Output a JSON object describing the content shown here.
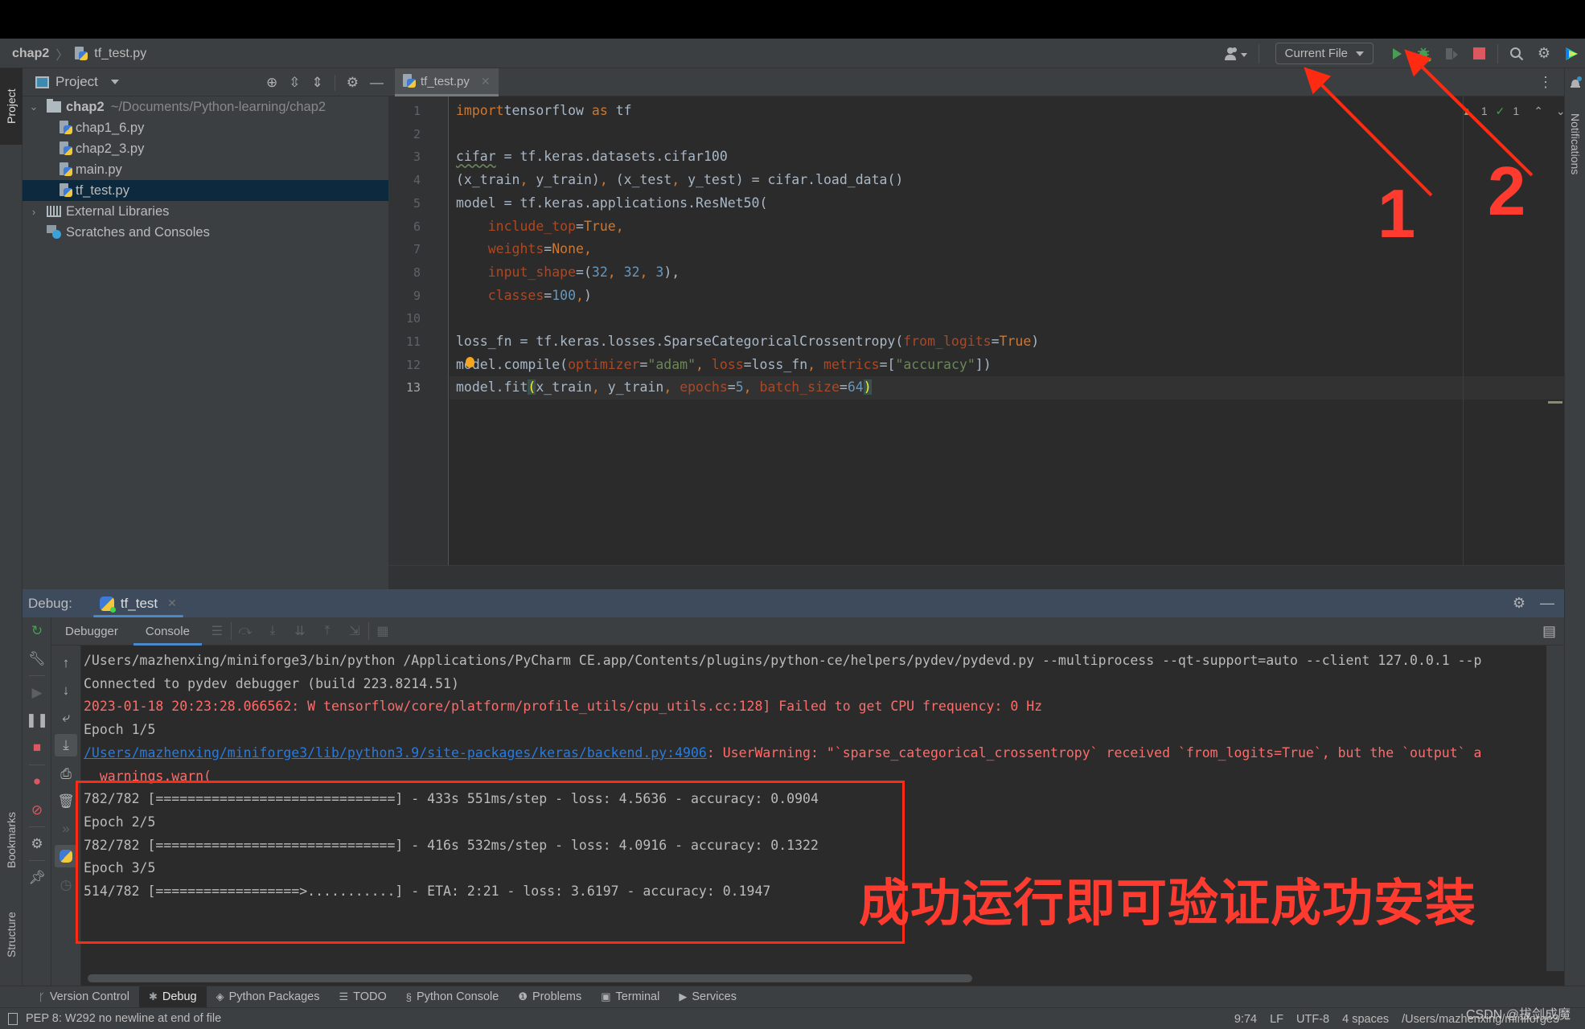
{
  "nav": {
    "project_name": "chap2",
    "file_name": "tf_test.py",
    "run_config": "Current File",
    "icons": [
      "user-icon",
      "run-icon",
      "debug-icon",
      "coverage-icon",
      "stop-icon",
      "search-icon",
      "settings-icon",
      "toolbox-icon"
    ]
  },
  "left_strip": {
    "project_tab": "Project",
    "bookmarks_tab": "Bookmarks",
    "structure_tab": "Structure"
  },
  "right_strip": {
    "notifications_tab": "Notifications"
  },
  "project_panel": {
    "title": "Project",
    "tree": [
      {
        "label": "chap2",
        "hint": "~/Documents/Python-learning/chap2",
        "type": "folder",
        "expanded": true,
        "level": 0
      },
      {
        "label": "chap1_6.py",
        "type": "python",
        "level": 1
      },
      {
        "label": "chap2_3.py",
        "type": "python",
        "level": 1
      },
      {
        "label": "main.py",
        "type": "python",
        "level": 1
      },
      {
        "label": "tf_test.py",
        "type": "python",
        "level": 1,
        "selected": true
      },
      {
        "label": "External Libraries",
        "type": "library",
        "expanded": false,
        "level": 0
      },
      {
        "label": "Scratches and Consoles",
        "type": "scratch",
        "level": 0
      }
    ]
  },
  "editor": {
    "tab_label": "tf_test.py",
    "current_line": 13,
    "inspections": {
      "warnings": "1",
      "weak_warnings": "1"
    },
    "lines": [
      {
        "n": "1",
        "tokens": [
          [
            "kw",
            "import"
          ],
          [
            "",
            "tensorflow "
          ],
          [
            "kw",
            "as"
          ],
          [
            "",
            " tf"
          ]
        ]
      },
      {
        "n": "2",
        "tokens": []
      },
      {
        "n": "3",
        "tokens": [
          [
            "squig",
            "cifar"
          ],
          [
            "",
            " = tf.keras.datasets.cifar100"
          ]
        ]
      },
      {
        "n": "4",
        "tokens": [
          [
            "",
            "(x_train"
          ],
          [
            "kw",
            ","
          ],
          [
            "",
            " y_train)"
          ],
          [
            "kw",
            ","
          ],
          [
            "",
            " (x_test"
          ],
          [
            "kw",
            ","
          ],
          [
            "",
            " y_test) = cifar.load_data()"
          ]
        ]
      },
      {
        "n": "5",
        "tokens": [
          [
            "",
            "model = tf.keras.applications.ResNet50("
          ]
        ]
      },
      {
        "n": "6",
        "tokens": [
          [
            "",
            "    "
          ],
          [
            "pa",
            "include_top"
          ],
          [
            "",
            "="
          ],
          [
            "kw",
            "True,"
          ]
        ]
      },
      {
        "n": "7",
        "tokens": [
          [
            "",
            "    "
          ],
          [
            "pa",
            "weights"
          ],
          [
            "",
            "="
          ],
          [
            "kw",
            "None,"
          ]
        ]
      },
      {
        "n": "8",
        "tokens": [
          [
            "",
            "    "
          ],
          [
            "pa",
            "input_shape"
          ],
          [
            "",
            "=("
          ],
          [
            "nu",
            "32"
          ],
          [
            "kw",
            ", "
          ],
          [
            "nu",
            "32"
          ],
          [
            "kw",
            ", "
          ],
          [
            "nu",
            "3"
          ],
          [
            "",
            "),"
          ]
        ]
      },
      {
        "n": "9",
        "tokens": [
          [
            "",
            "    "
          ],
          [
            "pa",
            "classes"
          ],
          [
            "",
            "="
          ],
          [
            "nu",
            "100"
          ],
          [
            "kw",
            ","
          ],
          [
            "",
            ")"
          ]
        ]
      },
      {
        "n": "10",
        "tokens": []
      },
      {
        "n": "11",
        "tokens": [
          [
            "",
            "loss_fn = tf.keras.losses.SparseCategoricalCrossentropy("
          ],
          [
            "pa",
            "from_logits"
          ],
          [
            "",
            "="
          ],
          [
            "kw",
            "True"
          ],
          [
            "",
            ")"
          ]
        ]
      },
      {
        "n": "12",
        "tokens": [
          [
            "",
            "model.compile("
          ],
          [
            "pa",
            "optimizer"
          ],
          [
            "",
            "="
          ],
          [
            "st",
            "\"adam\""
          ],
          [
            "kw",
            ", "
          ],
          [
            "pa",
            "loss"
          ],
          [
            "",
            "=loss_fn"
          ],
          [
            "kw",
            ", "
          ],
          [
            "pa",
            "metrics"
          ],
          [
            "",
            "=["
          ],
          [
            "st",
            "\"accuracy\""
          ],
          [
            "",
            "])"
          ]
        ]
      },
      {
        "n": "13",
        "tokens": [
          [
            "",
            "model.fit"
          ],
          [
            "hl",
            "("
          ],
          [
            "",
            "x_train"
          ],
          [
            "kw",
            ", "
          ],
          [
            "",
            "y_train"
          ],
          [
            "kw",
            ", "
          ],
          [
            "pa",
            "epochs"
          ],
          [
            "",
            "="
          ],
          [
            "nu",
            "5"
          ],
          [
            "kw",
            ", "
          ],
          [
            "pa",
            "batch_size"
          ],
          [
            "",
            "="
          ],
          [
            "nu",
            "64"
          ],
          [
            "hl",
            ")"
          ]
        ]
      }
    ]
  },
  "debug": {
    "label": "Debug:",
    "session_tab": "tf_test",
    "tabs": [
      "Debugger",
      "Console"
    ],
    "active_tab": "Console",
    "console_lines": [
      {
        "type": "normal",
        "text": "/Users/mazhenxing/miniforge3/bin/python /Applications/PyCharm CE.app/Contents/plugins/python-ce/helpers/pydev/pydevd.py --multiprocess --qt-support=auto --client 127.0.0.1 --p"
      },
      {
        "type": "normal",
        "text": "Connected to pydev debugger (build 223.8214.51)"
      },
      {
        "type": "err",
        "text": "2023-01-18 20:23:28.066562: W tensorflow/core/platform/profile_utils/cpu_utils.cc:128] Failed to get CPU frequency: 0 Hz"
      },
      {
        "type": "normal",
        "text": "Epoch 1/5"
      },
      {
        "type": "link",
        "link": "/Users/mazhenxing/miniforge3/lib/python3.9/site-packages/keras/backend.py:4906",
        "text": ": UserWarning: \"`sparse_categorical_crossentropy` received `from_logits=True`, but the `output` a"
      },
      {
        "type": "err",
        "text": "  warnings.warn("
      },
      {
        "type": "normal",
        "text": "782/782 [==============================] - 433s 551ms/step - loss: 4.5636 - accuracy: 0.0904"
      },
      {
        "type": "normal",
        "text": "Epoch 2/5"
      },
      {
        "type": "normal",
        "text": "782/782 [==============================] - 416s 532ms/step - loss: 4.0916 - accuracy: 0.1322"
      },
      {
        "type": "normal",
        "text": "Epoch 3/5"
      },
      {
        "type": "normal",
        "text": "514/782 [==================>...........] - ETA: 2:21 - loss: 3.6197 - accuracy: 0.1947"
      }
    ]
  },
  "annotations": {
    "caption": "成功运行即可验证成功安装",
    "marker_1": "1",
    "marker_2": "2",
    "color": "#ff3b30"
  },
  "bottom_tools": [
    {
      "label": "Version Control",
      "icon": "branch-icon"
    },
    {
      "label": "Debug",
      "icon": "bug-icon",
      "active": true
    },
    {
      "label": "Python Packages",
      "icon": "packages-icon"
    },
    {
      "label": "TODO",
      "icon": "list-icon"
    },
    {
      "label": "Python Console",
      "icon": "python-icon"
    },
    {
      "label": "Problems",
      "icon": "problems-icon"
    },
    {
      "label": "Terminal",
      "icon": "terminal-icon"
    },
    {
      "label": "Services",
      "icon": "services-icon"
    }
  ],
  "status": {
    "message": "PEP 8: W292 no newline at end of file",
    "position": "9:74",
    "line_sep": "LF",
    "encoding": "UTF-8",
    "indent": "4 spaces",
    "interpreter": "/Users/mazhenxing/miniforge3"
  },
  "watermark": "CSDN @拔剑成魔"
}
